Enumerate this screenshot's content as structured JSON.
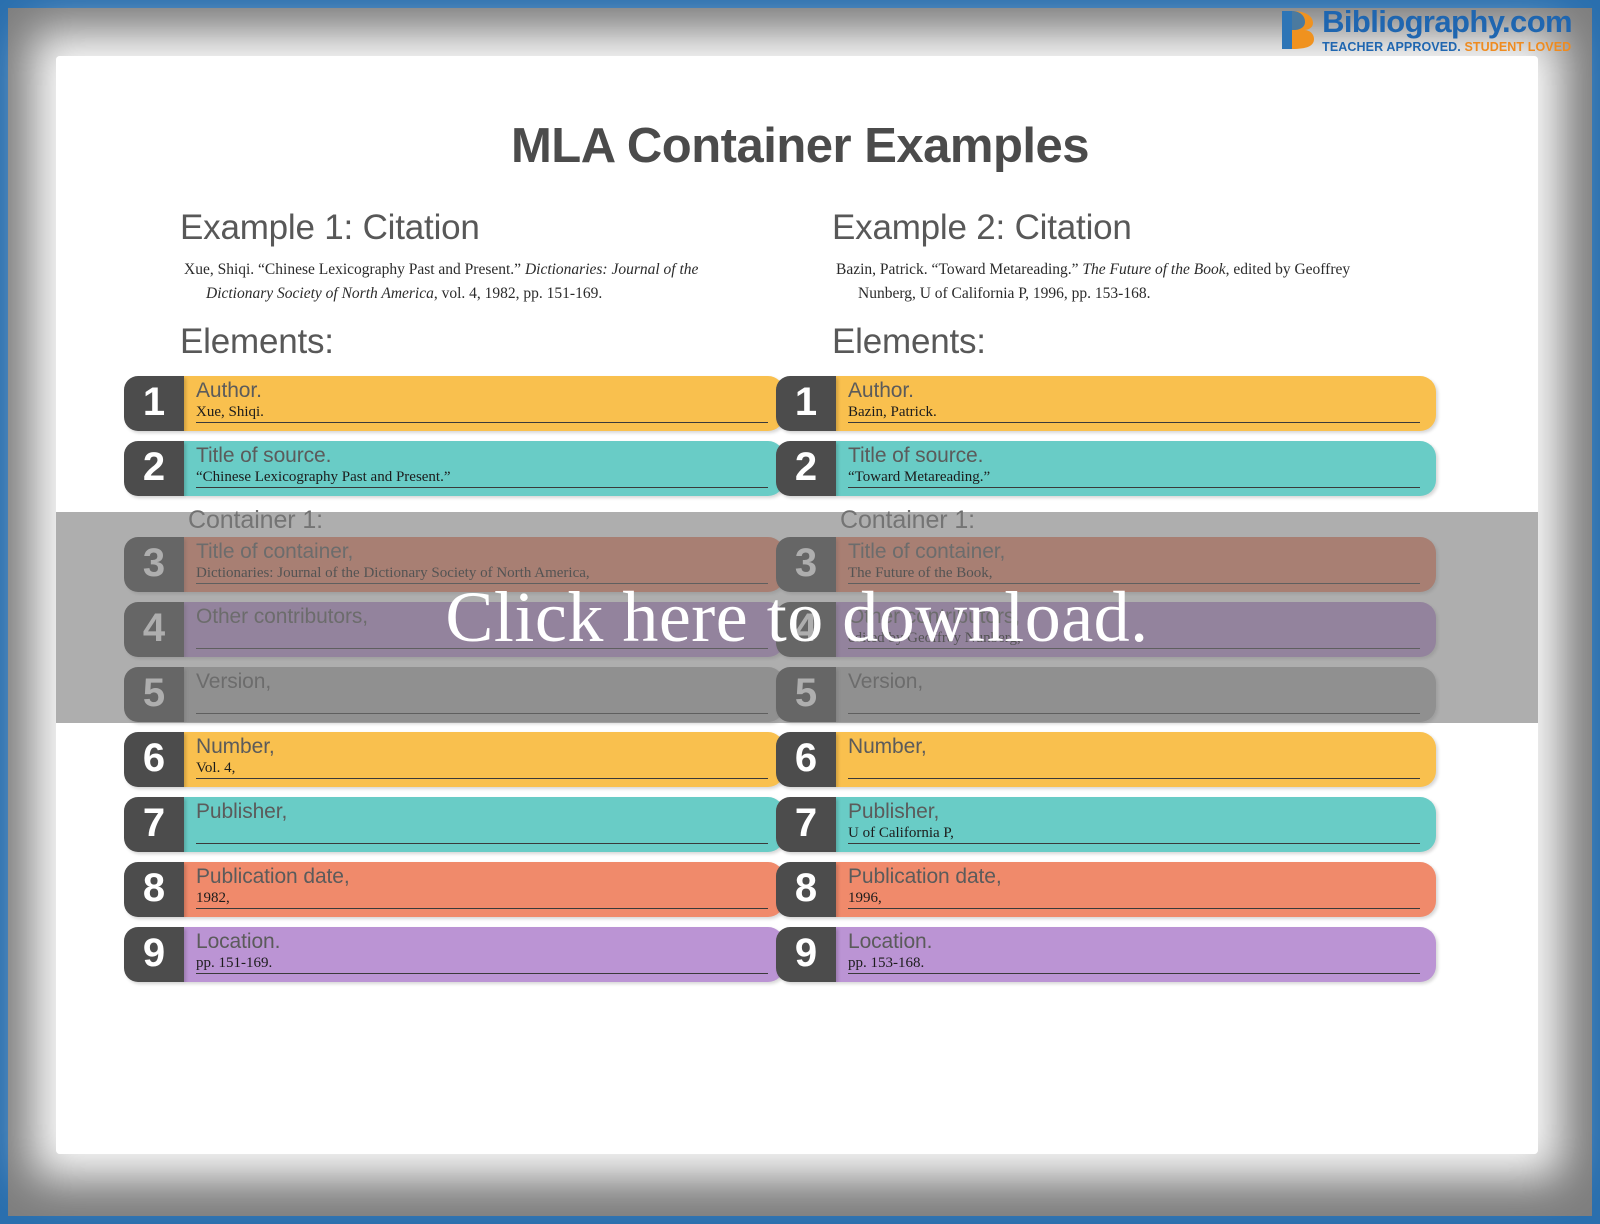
{
  "logo": {
    "mark": "b-mark-icon",
    "title": "Bibliography.com",
    "tagline_part1": "TEACHER APPROVED.",
    "tagline_part2": "STUDENT LOVED",
    "brand_blue": "#1f66b0",
    "brand_orange": "#ef8b1f"
  },
  "page": {
    "title": "MLA Container Examples",
    "elements_heading": "Elements:",
    "container_label": "Container 1:"
  },
  "overlay": {
    "text": "Click here to download."
  },
  "colors": {
    "yellow": "#f9c04e",
    "teal": "#69ccc6",
    "salmon": "#f08a6b",
    "purple": "#bb94d4",
    "gray": "#b3b3b3",
    "badge": "#4c4c4c",
    "heading": "#585858"
  },
  "examples": [
    {
      "heading": "Example 1: Citation",
      "citation": [
        {
          "text": "Xue, Shiqi. “Chinese Lexicography Past and Present.” ",
          "italic": false
        },
        {
          "text": "Dictionaries: Journal of the Dictionary Society of North America",
          "italic": true
        },
        {
          "text": ", vol. 4, 1982, pp. 151-169.",
          "italic": false
        }
      ],
      "rows": [
        {
          "num": "1",
          "label": "Author.",
          "value": "Xue, Shiqi.",
          "color": "#f9c04e",
          "container_start": false
        },
        {
          "num": "2",
          "label": "Title of source.",
          "value": "“Chinese Lexicography Past and Present.”",
          "color": "#69ccc6",
          "container_start": false
        },
        {
          "num": "3",
          "label": "Title of container,",
          "value": "Dictionaries: Journal of the Dictionary Society of North America,",
          "color": "#f08a6b",
          "container_start": true
        },
        {
          "num": "4",
          "label": "Other contributors,",
          "value": "",
          "color": "#bb94d4",
          "container_start": false
        },
        {
          "num": "5",
          "label": "Version,",
          "value": "",
          "color": "#b3b3b3",
          "container_start": false
        },
        {
          "num": "6",
          "label": "Number,",
          "value": "Vol. 4,",
          "color": "#f9c04e",
          "container_start": false
        },
        {
          "num": "7",
          "label": "Publisher,",
          "value": "",
          "color": "#69ccc6",
          "container_start": false
        },
        {
          "num": "8",
          "label": "Publication date,",
          "value": "1982,",
          "color": "#f08a6b",
          "container_start": false
        },
        {
          "num": "9",
          "label": "Location.",
          "value": "pp. 151-169.",
          "color": "#bb94d4",
          "container_start": false
        }
      ]
    },
    {
      "heading": "Example 2: Citation",
      "citation": [
        {
          "text": "Bazin, Patrick. “Toward Metareading.” ",
          "italic": false
        },
        {
          "text": "The Future of the Book",
          "italic": true
        },
        {
          "text": ", edited by Geoffrey Nunberg, U of California P, 1996, pp. 153-168.",
          "italic": false
        }
      ],
      "rows": [
        {
          "num": "1",
          "label": "Author.",
          "value": "Bazin, Patrick.",
          "color": "#f9c04e",
          "container_start": false
        },
        {
          "num": "2",
          "label": "Title of source.",
          "value": "“Toward Metareading.”",
          "color": "#69ccc6",
          "container_start": false
        },
        {
          "num": "3",
          "label": "Title of container,",
          "value": "The Future of the Book,",
          "color": "#f08a6b",
          "container_start": true
        },
        {
          "num": "4",
          "label": "Other contributors,",
          "value": "edited by Geoffrey Nunberg,",
          "color": "#bb94d4",
          "container_start": false
        },
        {
          "num": "5",
          "label": "Version,",
          "value": "",
          "color": "#b3b3b3",
          "container_start": false
        },
        {
          "num": "6",
          "label": "Number,",
          "value": "",
          "color": "#f9c04e",
          "container_start": false
        },
        {
          "num": "7",
          "label": "Publisher,",
          "value": "U of California P,",
          "color": "#69ccc6",
          "container_start": false
        },
        {
          "num": "8",
          "label": "Publication date,",
          "value": "1996,",
          "color": "#f08a6b",
          "container_start": false
        },
        {
          "num": "9",
          "label": "Location.",
          "value": "pp. 153-168.",
          "color": "#bb94d4",
          "container_start": false
        }
      ]
    }
  ]
}
